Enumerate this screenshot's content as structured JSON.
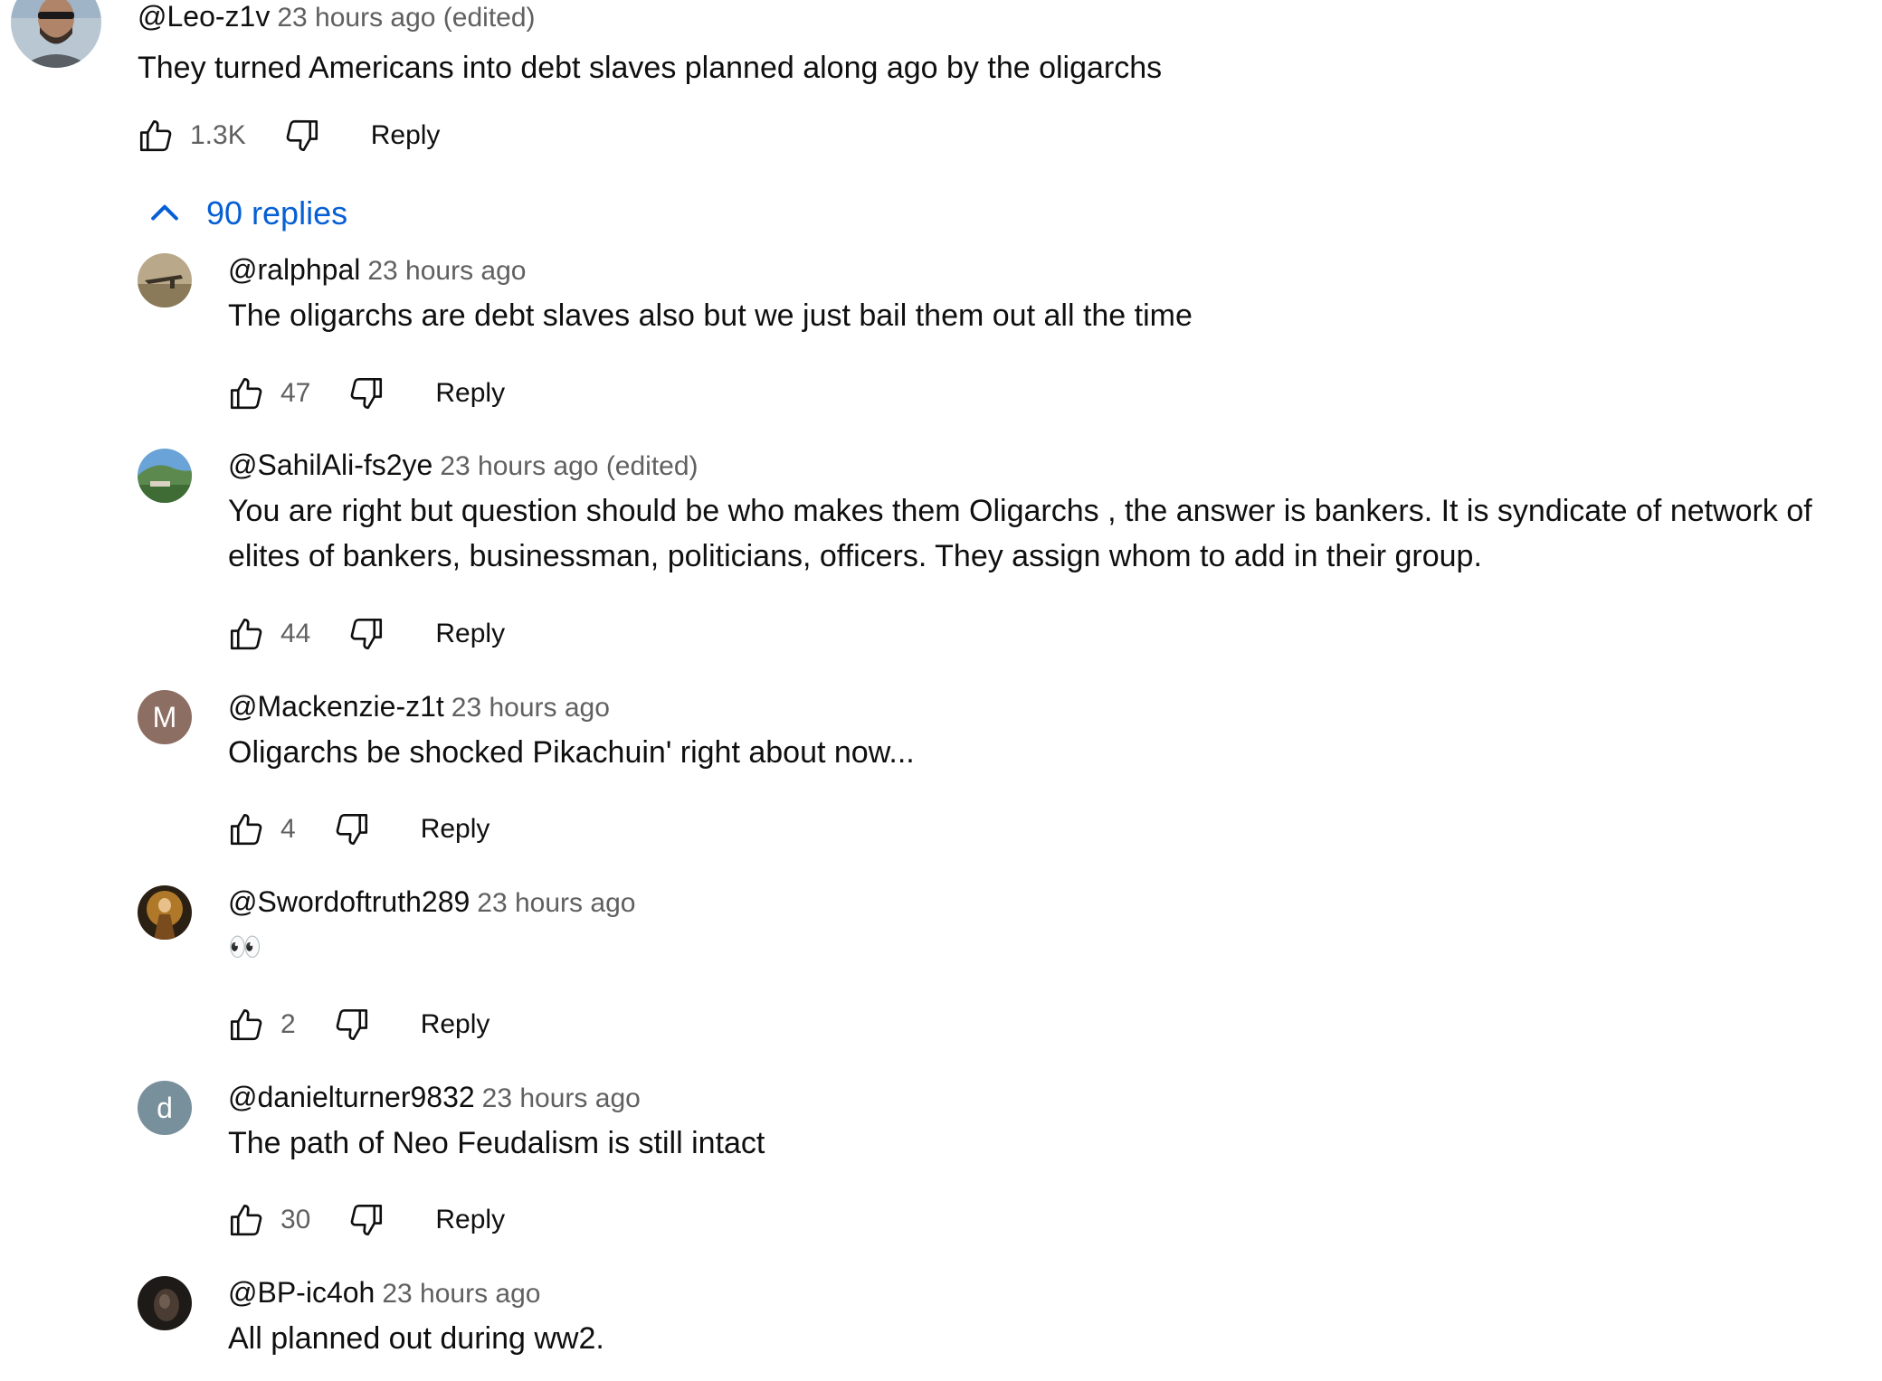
{
  "main_comment": {
    "author": "@Leo-z1v",
    "timestamp": "23 hours ago (edited)",
    "text": "They turned Americans into debt slaves planned along ago by the oligarchs",
    "likes": "1.3K",
    "reply_label": "Reply"
  },
  "replies_toggle": {
    "label": "90 replies",
    "accent_color": "#065fd4"
  },
  "replies": [
    {
      "author": "@ralphpal",
      "timestamp": "23 hours ago",
      "text": "The oligarchs are debt slaves also but we just bail them out all the time",
      "likes": "47",
      "reply_label": "Reply"
    },
    {
      "author": "@SahilAli-fs2ye",
      "timestamp": "23 hours ago (edited)",
      "text": "You are right but question should be who makes them Oligarchs , the answer is bankers. It is syndicate of network of elites of bankers,  businessman, politicians,   officers. They assign whom to add in their group.",
      "likes": "44",
      "reply_label": "Reply"
    },
    {
      "author": "@Mackenzie-z1t",
      "timestamp": "23 hours ago",
      "text": "Oligarchs be shocked Pikachuin' right about now...",
      "likes": "4",
      "reply_label": "Reply",
      "avatar_letter": "M",
      "avatar_color": "#8d6e63"
    },
    {
      "author": "@Swordoftruth289",
      "timestamp": "23 hours ago",
      "text": "👀",
      "likes": "2",
      "reply_label": "Reply"
    },
    {
      "author": "@danielturner9832",
      "timestamp": "23 hours ago",
      "text": "The path of Neo Feudalism is still intact",
      "likes": "30",
      "reply_label": "Reply",
      "avatar_letter": "d",
      "avatar_color": "#78909c"
    },
    {
      "author": "@BP-ic4oh",
      "timestamp": "23 hours ago",
      "text": "All planned out during ww2.",
      "reply_label": "Reply"
    }
  ],
  "icons": {
    "like": "thumb-up-icon",
    "dislike": "thumb-down-icon",
    "collapse": "chevron-up-icon"
  }
}
